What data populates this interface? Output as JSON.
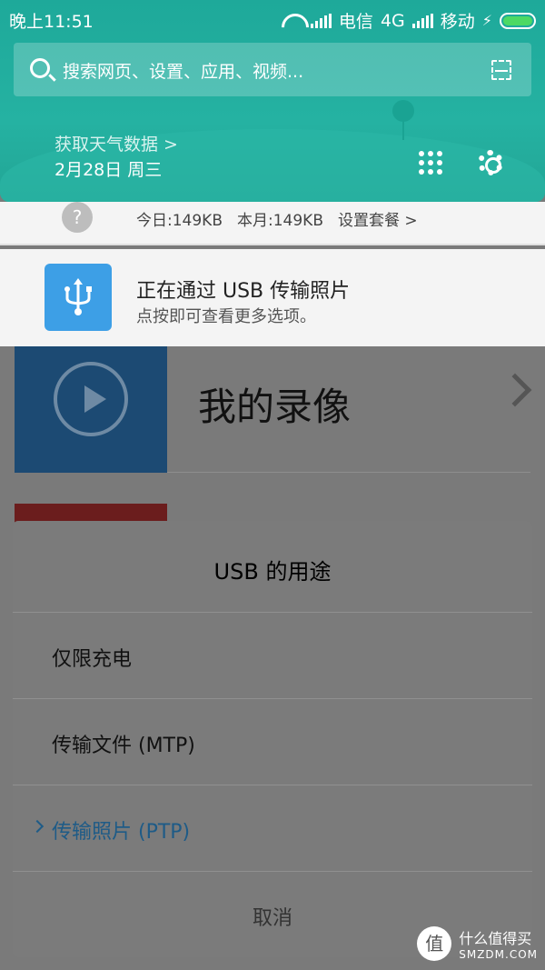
{
  "status_bar": {
    "time": "晚上11:51",
    "carrier1": "电信",
    "network": "4G",
    "carrier2": "移动",
    "battery_level": 1.0,
    "battery_color": "#4cd964"
  },
  "shade": {
    "search_placeholder": "搜索网页、设置、应用、视频...",
    "weather_link": "获取天气数据 >",
    "date": "2月28日 周三",
    "accent": "#1ea99a",
    "icons": [
      "search-icon",
      "scan-icon",
      "apps-grid-icon",
      "gear-icon"
    ]
  },
  "data_usage": {
    "today": "今日:149KB",
    "month": "本月:149KB",
    "setup": "设置套餐 >"
  },
  "usb_notification": {
    "title": "正在通过 USB 传输照片",
    "subtitle": "点按即可查看更多选项。",
    "icon": "usb-icon",
    "icon_color": "#3d9fe6"
  },
  "background_app": {
    "title": "我的录像"
  },
  "dialog": {
    "title": "USB 的用途",
    "options": [
      {
        "label": "仅限充电",
        "selected": false
      },
      {
        "label": "传输文件 (MTP)",
        "selected": false
      },
      {
        "label": "传输照片 (PTP)",
        "selected": true
      }
    ],
    "cancel": "取消"
  },
  "watermark": {
    "logo": "值",
    "name": "什么值得买",
    "site": "SMZDM.COM"
  }
}
